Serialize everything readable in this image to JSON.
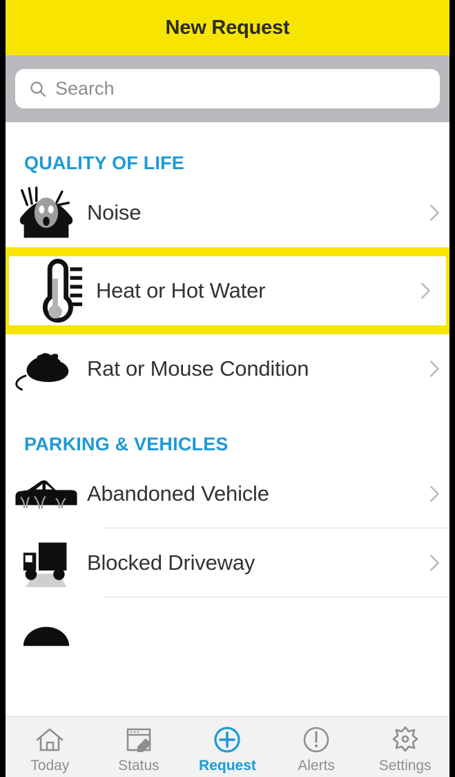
{
  "header": {
    "title": "New Request",
    "background_color": "#f7e400",
    "title_color": "#2b2b28"
  },
  "search": {
    "placeholder": "Search",
    "value": "",
    "icon": "search-icon"
  },
  "accent_color": "#1c9ad6",
  "highlight_color": "#f7e400",
  "sections": [
    {
      "title": "QUALITY OF LIFE",
      "items": [
        {
          "label": "Noise",
          "icon": "noise-icon",
          "highlighted": false
        },
        {
          "label": "Heat or Hot Water",
          "icon": "thermometer-icon",
          "highlighted": true
        },
        {
          "label": "Rat or Mouse Condition",
          "icon": "rat-icon",
          "highlighted": false
        }
      ]
    },
    {
      "title": "PARKING & VEHICLES",
      "items": [
        {
          "label": "Abandoned Vehicle",
          "icon": "car-weeds-icon",
          "highlighted": false
        },
        {
          "label": "Blocked Driveway",
          "icon": "truck-icon",
          "highlighted": false
        }
      ]
    }
  ],
  "tabbar": {
    "tabs": [
      {
        "label": "Today",
        "icon": "home-icon",
        "active": false
      },
      {
        "label": "Status",
        "icon": "window-pencil-icon",
        "active": false
      },
      {
        "label": "Request",
        "icon": "plus-circle-icon",
        "active": true
      },
      {
        "label": "Alerts",
        "icon": "exclamation-circle-icon",
        "active": false
      },
      {
        "label": "Settings",
        "icon": "gear-icon",
        "active": false
      }
    ]
  }
}
